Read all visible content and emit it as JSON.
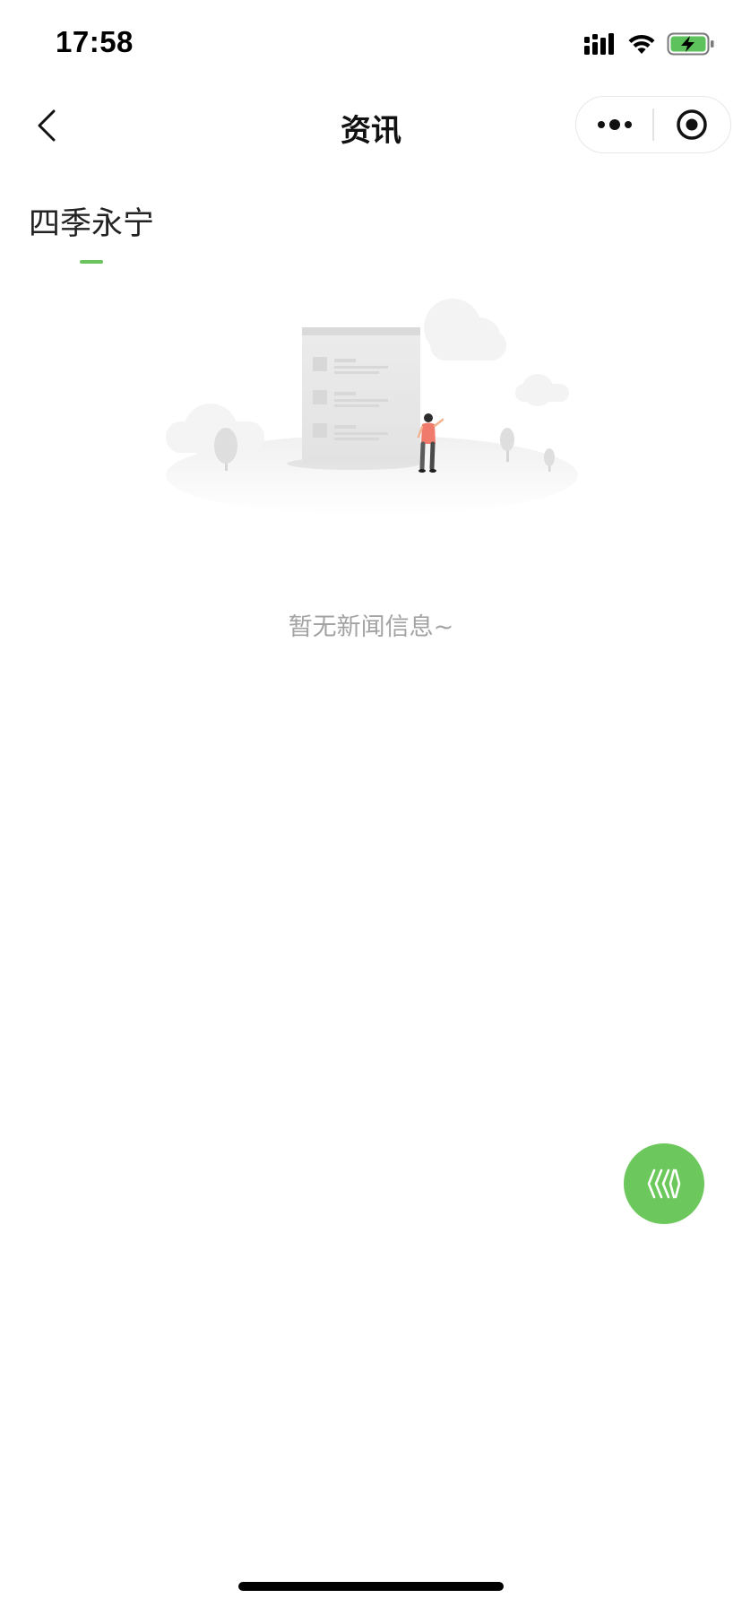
{
  "status_bar": {
    "time": "17:58",
    "icons": [
      "cellular-signal-icon",
      "wifi-icon",
      "battery-charging-icon"
    ],
    "battery_color": "#5dc25b"
  },
  "nav": {
    "title": "资讯",
    "back_icon": "chevron-left-icon",
    "more_icon": "more-dots-icon",
    "close_icon": "target-close-icon"
  },
  "tabs": [
    {
      "label": "四季永宁",
      "active": true
    }
  ],
  "accent_color": "#6ac35d",
  "empty_state": {
    "illustration": "empty-news-illustration",
    "message": "暂无新闻信息~"
  },
  "fab": {
    "icon": "chevron-stripes-icon",
    "color": "#6cc85c"
  }
}
